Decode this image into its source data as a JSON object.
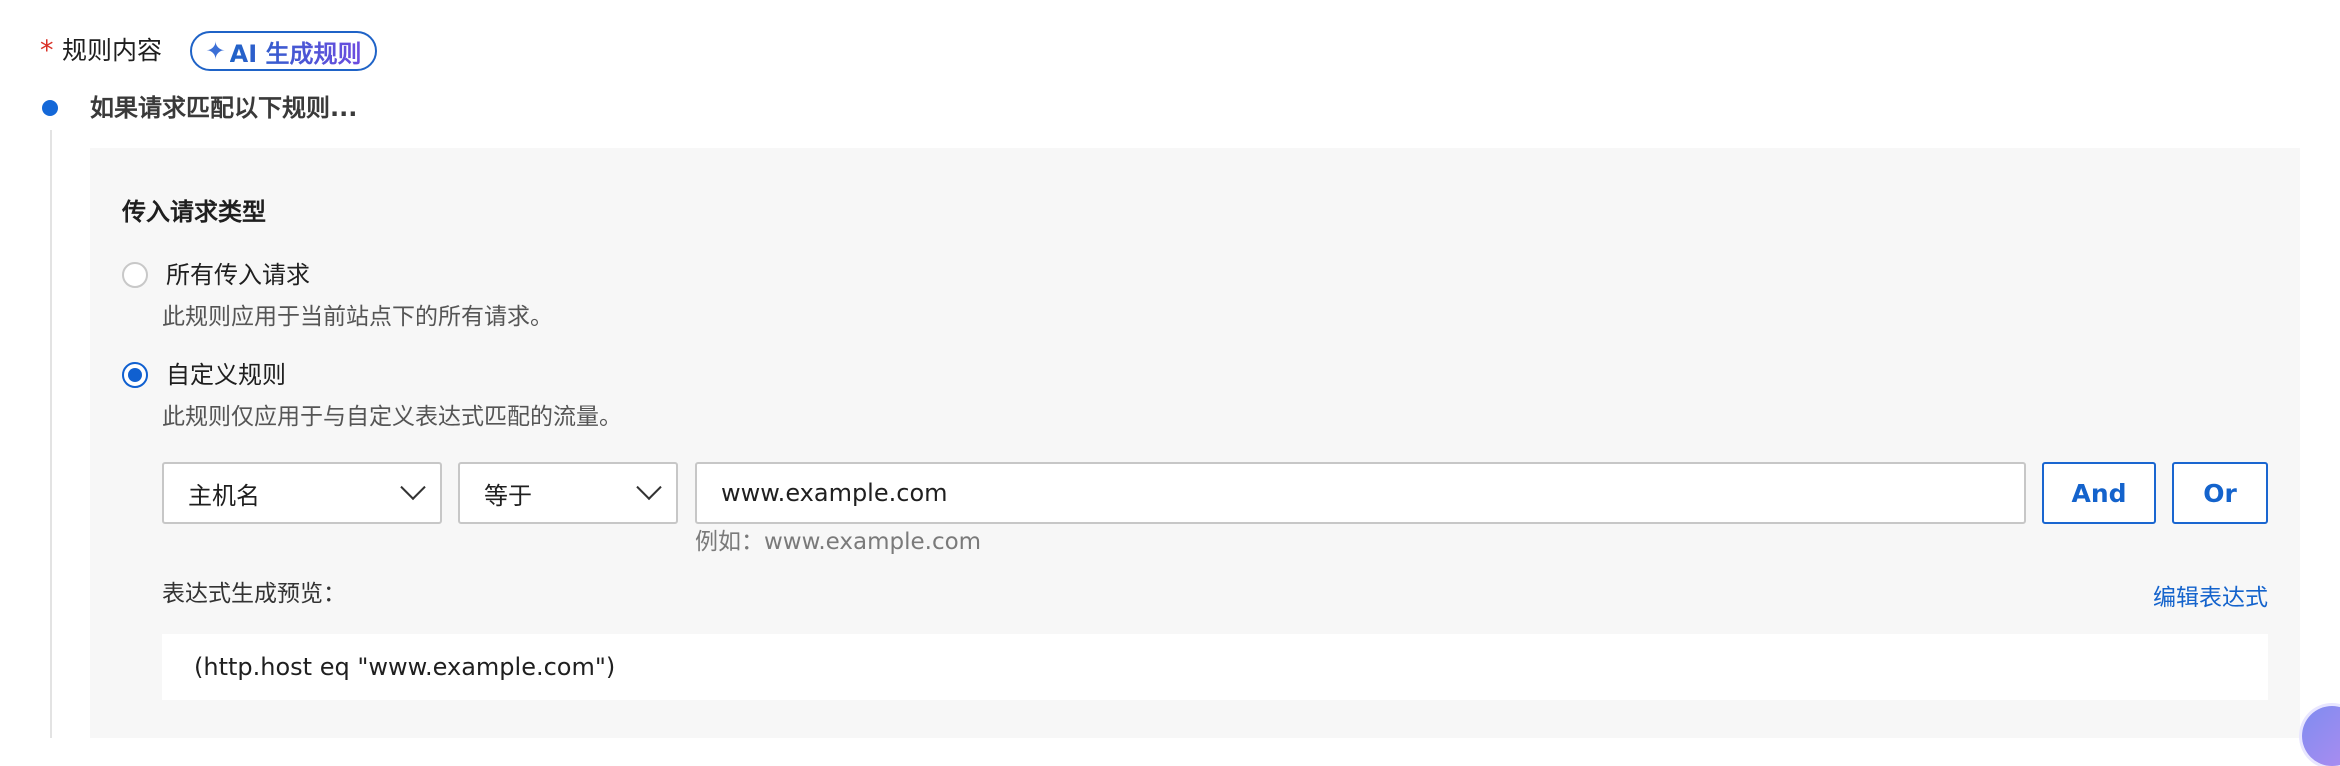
{
  "section": {
    "required_marker": "*",
    "label": "规则内容",
    "ai_button": {
      "icon": "sparkle-icon",
      "label": "AI 生成规则"
    }
  },
  "step": {
    "title": "如果请求匹配以下规则..."
  },
  "panel": {
    "title": "传入请求类型",
    "options": [
      {
        "label": "所有传入请求",
        "description": "此规则应用于当前站点下的所有请求。",
        "checked": false
      },
      {
        "label": "自定义规则",
        "description": "此规则仅应用于与自定义表达式匹配的流量。",
        "checked": true
      }
    ]
  },
  "condition": {
    "field_select": "主机名",
    "operator_select": "等于",
    "value": "www.example.com",
    "hint": "例如：www.example.com",
    "and_label": "And",
    "or_label": "Or"
  },
  "preview": {
    "label": "表达式生成预览：",
    "edit_link": "编辑表达式",
    "expression": "(http.host eq \"www.example.com\")"
  },
  "colors": {
    "accent": "#1463cc",
    "required": "#d93026",
    "panel_bg": "#f7f7f7"
  }
}
